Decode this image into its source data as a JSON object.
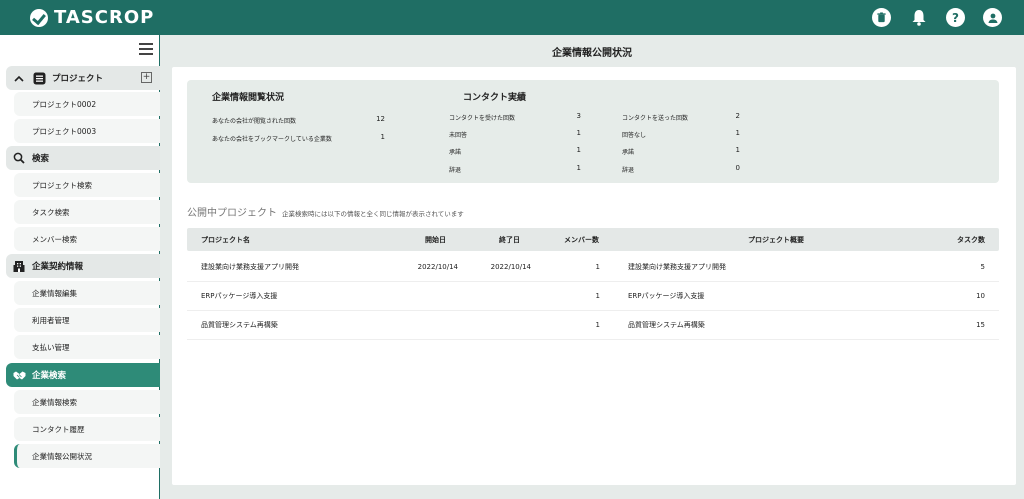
{
  "app": {
    "logo": "TASCROP"
  },
  "header_icons": [
    "trash-icon",
    "bell-icon",
    "help-icon",
    "user-icon"
  ],
  "header_icon_glyphs": {
    "help": "?"
  },
  "sidebar": {
    "project_head": "プロジェクト",
    "projects": [
      "プロジェクト0002",
      "プロジェクト0003"
    ],
    "search_head": "検索",
    "search_items": [
      "プロジェクト検索",
      "タスク検索",
      "メンバー検索"
    ],
    "contract_head": "企業契約情報",
    "contract_items": [
      "企業情報編集",
      "利用者管理",
      "支払い管理"
    ],
    "company_search_head": "企業検索",
    "company_search_items": [
      "企業情報検索",
      "コンタクト履歴",
      "企業情報公開状況"
    ],
    "plus": "+"
  },
  "main": {
    "page_title": "企業情報公開状況",
    "view_stats": {
      "title": "企業情報閲覧状況",
      "items": [
        {
          "label": "あなたの会社が閲覧された回数",
          "value": "12"
        },
        {
          "label": "あなたの会社をブックマークしている企業数",
          "value": "1"
        }
      ]
    },
    "contact_stats": {
      "title": "コンタクト実績",
      "received": [
        {
          "label": "コンタクトを受けた回数",
          "value": "3"
        },
        {
          "label": "未回答",
          "value": "1"
        },
        {
          "label": "承諾",
          "value": "1"
        },
        {
          "label": "辞退",
          "value": "1"
        }
      ],
      "sent": [
        {
          "label": "コンタクトを送った回数",
          "value": "2"
        },
        {
          "label": "回答なし",
          "value": "1"
        },
        {
          "label": "承諾",
          "value": "1"
        },
        {
          "label": "辞退",
          "value": "0"
        }
      ]
    },
    "public_projects": {
      "title": "公開中プロジェクト",
      "note": "企業検索時には以下の情報と全く同じ情報が表示されています",
      "columns": [
        "プロジェクト名",
        "開始日",
        "終了日",
        "メンバー数",
        "プロジェクト概要",
        "タスク数"
      ],
      "rows": [
        [
          "建設業向け業務支援アプリ開発",
          "2022/10/14",
          "2022/10/14",
          "1",
          "建設業向け業務支援アプリ開発",
          "5"
        ],
        [
          "ERPパッケージ導入支援",
          "",
          "",
          "1",
          "ERPパッケージ導入支援",
          "10"
        ],
        [
          "品質管理システム再構築",
          "",
          "",
          "1",
          "品質管理システム再構築",
          "15"
        ]
      ]
    }
  }
}
